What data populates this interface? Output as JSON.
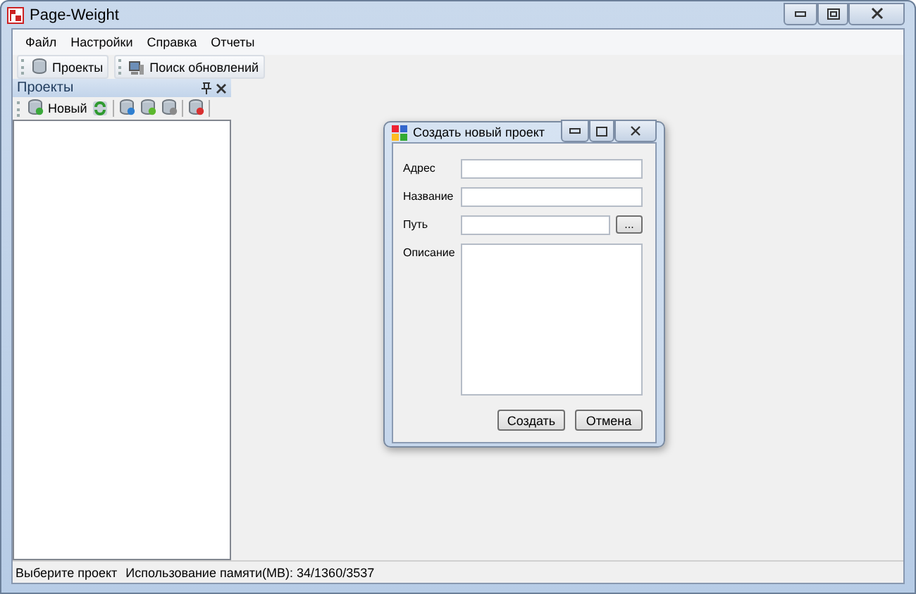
{
  "window": {
    "title": "Page-Weight"
  },
  "menu": [
    "Файл",
    "Настройки",
    "Справка",
    "Отчеты"
  ],
  "toolbar": [
    {
      "kind": "projects",
      "label": "Проекты"
    },
    {
      "kind": "updates",
      "label": "Поиск обновлений"
    }
  ],
  "panel": {
    "title": "Проекты",
    "tools": [
      {
        "kind": "new",
        "label": "Новый"
      },
      {
        "kind": "refresh"
      },
      {
        "kind": "separator"
      },
      {
        "kind": "save"
      },
      {
        "kind": "open"
      },
      {
        "kind": "settings"
      },
      {
        "kind": "separator"
      },
      {
        "kind": "delete"
      },
      {
        "kind": "separator"
      }
    ]
  },
  "dialog": {
    "title": "Создать новый проект",
    "fields": [
      {
        "kind": "text",
        "label": "Адрес"
      },
      {
        "kind": "text",
        "label": "Название"
      },
      {
        "kind": "browse",
        "label": "Путь",
        "button": "..."
      },
      {
        "kind": "multiline",
        "label": "Описание"
      }
    ],
    "buttons": [
      "Создать",
      "Отмена"
    ]
  },
  "status_bar": {
    "text": "Выберите проект",
    "memory": "Использование памяти(MB): 34/1360/3537"
  }
}
